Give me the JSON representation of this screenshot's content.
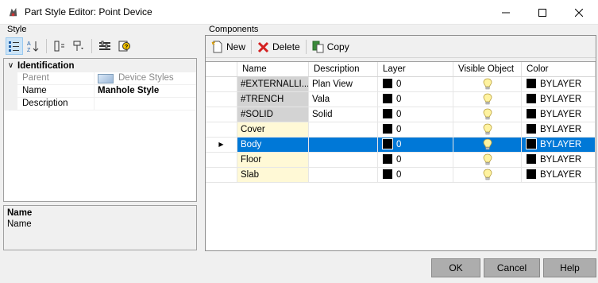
{
  "window": {
    "title": "Part Style Editor: Point Device",
    "controls": [
      "minimize",
      "maximize",
      "close"
    ]
  },
  "style_group": {
    "label": "Style",
    "toolbar": [
      "categorized-icon",
      "alphabetical-icon",
      "expand-icon",
      "filter-icon",
      "properties-icon",
      "help-icon"
    ],
    "category": "Identification",
    "properties": [
      {
        "name": "Parent",
        "value": "Device Styles",
        "readonly": true
      },
      {
        "name": "Name",
        "value": "Manhole Style",
        "readonly": false
      },
      {
        "name": "Description",
        "value": "",
        "readonly": false
      }
    ],
    "description_box": {
      "title": "Name",
      "text": "Name"
    }
  },
  "components_group": {
    "label": "Components",
    "toolbar": {
      "new_label": "New",
      "delete_label": "Delete",
      "copy_label": "Copy"
    },
    "columns": [
      "Name",
      "Description",
      "Layer",
      "Visible Object",
      "Color"
    ],
    "rows": [
      {
        "name": "#EXTERNALLI...",
        "description": "Plan View",
        "layer": "0",
        "visible": true,
        "color": "BYLAYER",
        "style": "grey",
        "selected": false
      },
      {
        "name": "#TRENCH",
        "description": "Vala",
        "layer": "0",
        "visible": true,
        "color": "BYLAYER",
        "style": "grey",
        "selected": false
      },
      {
        "name": "#SOLID",
        "description": "Solid",
        "layer": "0",
        "visible": true,
        "color": "BYLAYER",
        "style": "grey",
        "selected": false
      },
      {
        "name": "Cover",
        "description": "",
        "layer": "0",
        "visible": true,
        "color": "BYLAYER",
        "style": "yellow",
        "selected": false
      },
      {
        "name": "Body",
        "description": "",
        "layer": "0",
        "visible": true,
        "color": "BYLAYER",
        "style": "yellow",
        "selected": true
      },
      {
        "name": "Floor",
        "description": "",
        "layer": "0",
        "visible": true,
        "color": "BYLAYER",
        "style": "yellow",
        "selected": false
      },
      {
        "name": "Slab",
        "description": "",
        "layer": "0",
        "visible": true,
        "color": "BYLAYER",
        "style": "yellow",
        "selected": false
      }
    ]
  },
  "buttons": {
    "ok": "OK",
    "cancel": "Cancel",
    "help": "Help"
  },
  "colors": {
    "selection": "#0078d7",
    "name_grey": "#d3d3d3",
    "name_yellow": "#fff9d6",
    "button_bg": "#adadad"
  }
}
